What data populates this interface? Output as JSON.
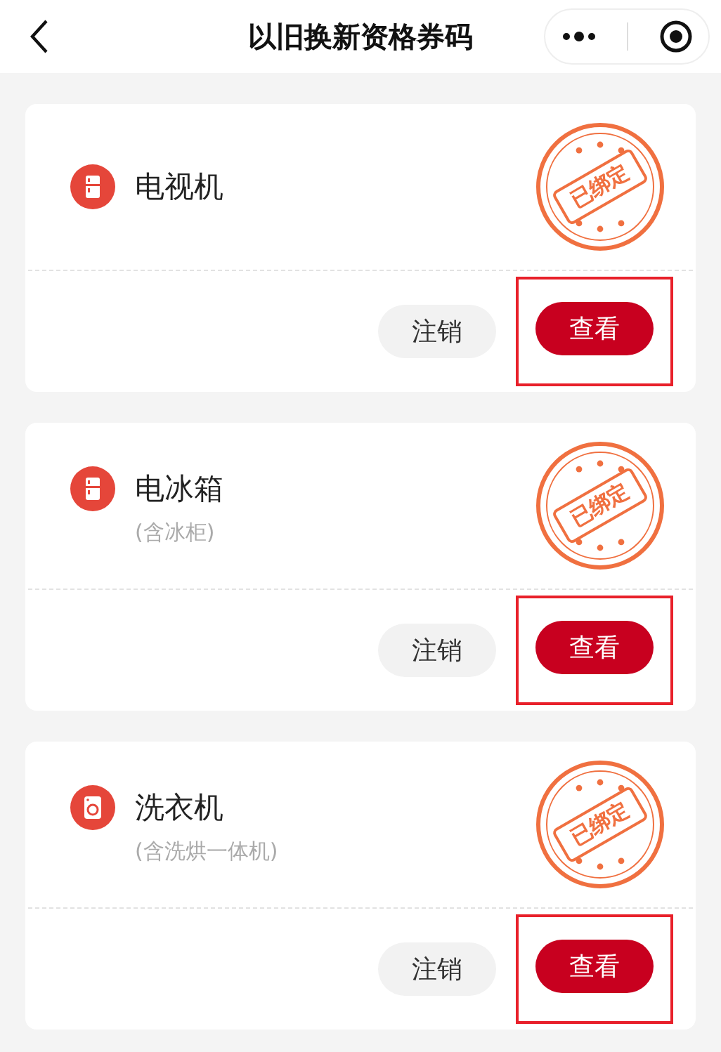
{
  "header": {
    "title": "以旧换新资格券码"
  },
  "cards": [
    {
      "kind": "fridge",
      "name": "电视机",
      "stamp": "已绑定",
      "cancel": "注销",
      "view": "查看",
      "highlighted": true
    },
    {
      "kind": "fridge",
      "name": "电冰箱",
      "note": "(含冰柜)",
      "stamp": "已绑定",
      "cancel": "注销",
      "view": "查看",
      "highlighted": true
    },
    {
      "kind": "washer",
      "name": "洗衣机",
      "note": "(含洗烘一体机)",
      "stamp": "已绑定",
      "cancel": "注销",
      "view": "查看",
      "highlighted": true
    }
  ]
}
